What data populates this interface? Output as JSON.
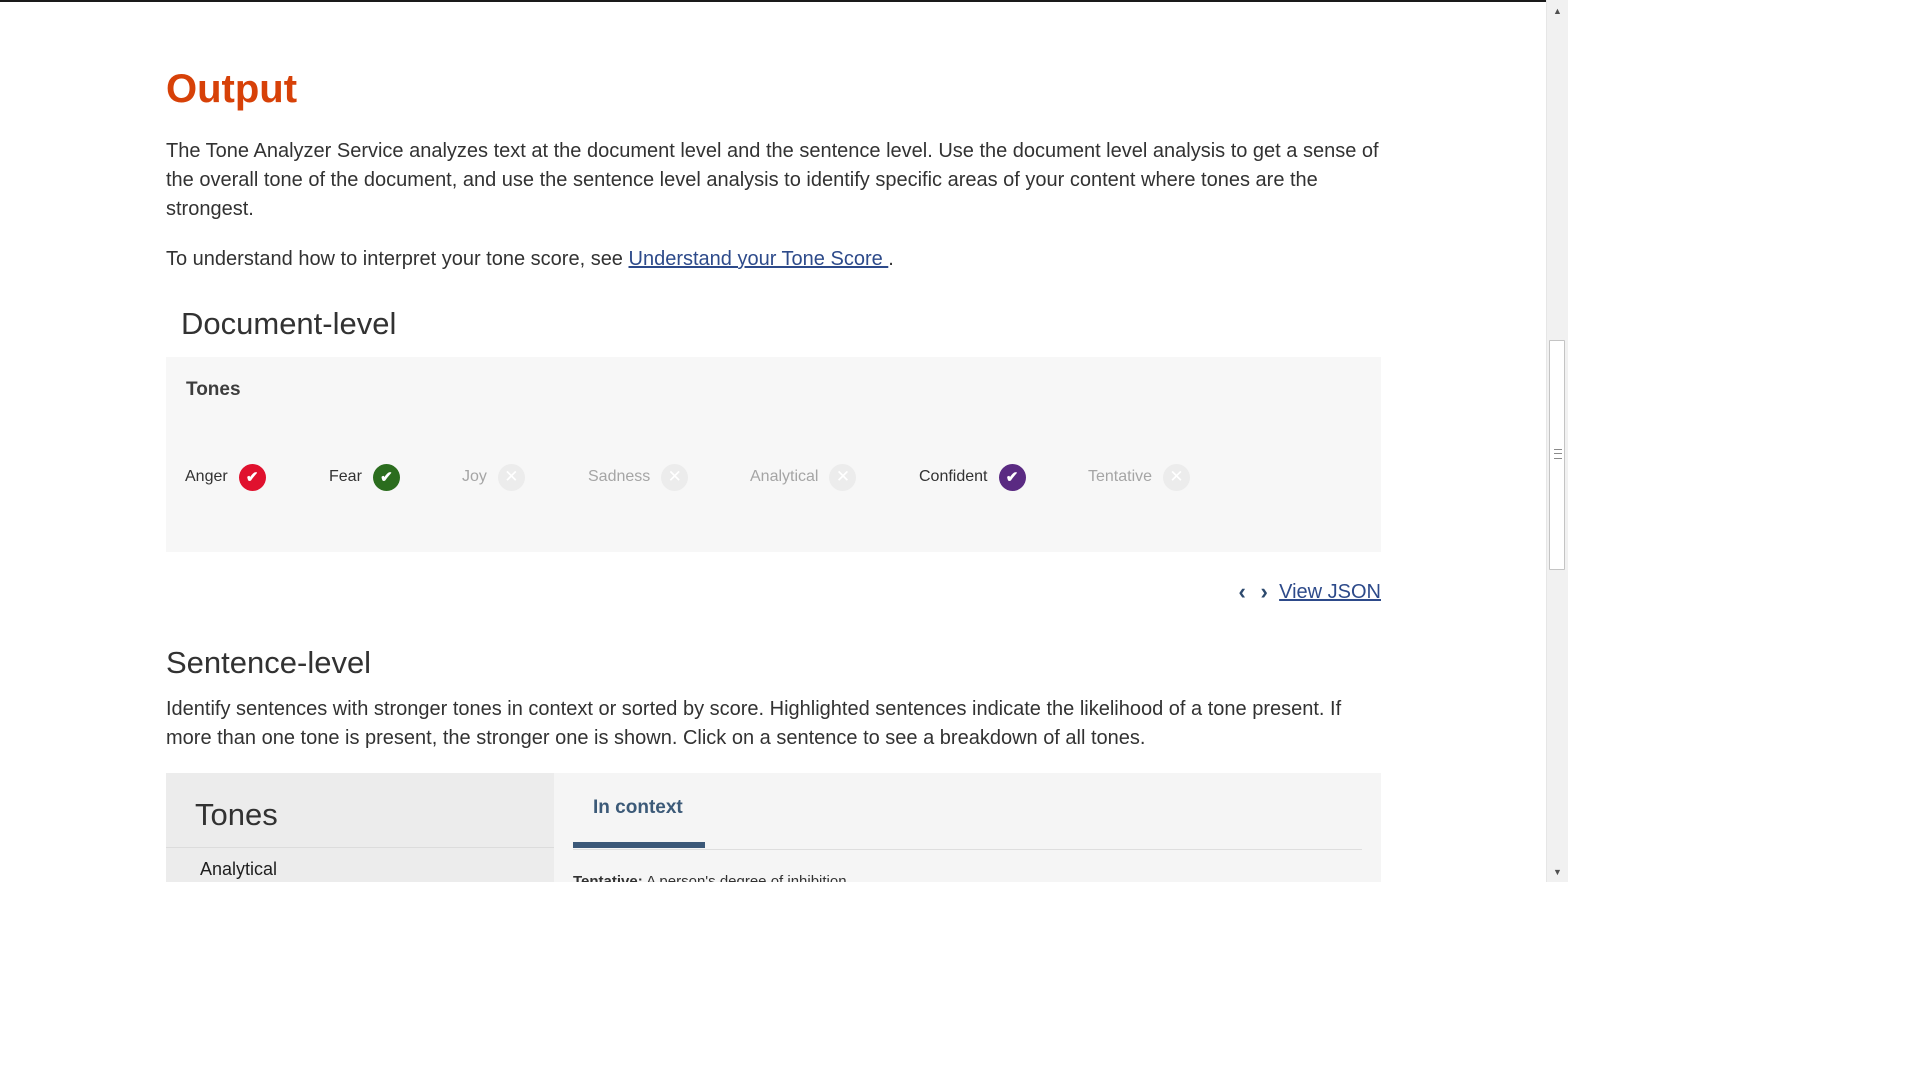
{
  "output": {
    "title": "Output",
    "intro": "The Tone Analyzer Service analyzes text at the document level and the sentence level. Use the document level analysis to get a sense of the overall tone of the document, and use the sentence level analysis to identify specific areas of your content where tones are the strongest.",
    "understand_prefix": "To understand how to interpret your tone score, see ",
    "understand_link": "Understand your Tone Score ",
    "understand_suffix": "."
  },
  "document_level": {
    "title": "Document-level",
    "tones_label": "Tones",
    "tones": [
      {
        "name": "Anger",
        "active": true,
        "color": "#e0112e"
      },
      {
        "name": "Fear",
        "active": true,
        "color": "#2b6d1e"
      },
      {
        "name": "Joy",
        "active": false,
        "color": "#ececec"
      },
      {
        "name": "Sadness",
        "active": false,
        "color": "#ececec"
      },
      {
        "name": "Analytical",
        "active": false,
        "color": "#ececec"
      },
      {
        "name": "Confident",
        "active": true,
        "color": "#5a2a82"
      },
      {
        "name": "Tentative",
        "active": false,
        "color": "#ececec"
      }
    ],
    "view_json": "View JSON",
    "prev_icon": "chevron-left-icon",
    "next_icon": "chevron-right-icon"
  },
  "sentence_level": {
    "title": "Sentence-level",
    "description": "Identify sentences with stronger tones in context or sorted by score. Highlighted sentences indicate the likelihood of a tone present. If more than one tone is present, the stronger one is shown. Click on a sentence to see a breakdown of all tones.",
    "left_title": "Tones",
    "left_items": [
      "Analytical"
    ],
    "tab_active": "In context",
    "cut_label": "Tentative:",
    "cut_text": " A person's degree of inhibition"
  },
  "colors": {
    "title_orange": "#d74108",
    "link_blue": "#2d4a8a",
    "tab_blue": "#3b5878"
  }
}
